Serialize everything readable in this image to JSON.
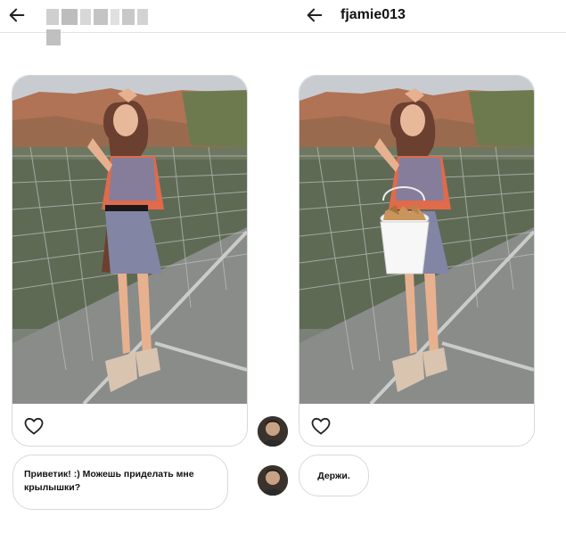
{
  "left_panel": {
    "header": {
      "back_icon": "arrow-left-icon",
      "username_blurred": true
    },
    "photo": {
      "description_icon": "photo-woman-on-bridge"
    },
    "like_icon": "heart-outline-icon",
    "message": "Приветик! :) Можешь приделать мне крылышки?"
  },
  "right_panel": {
    "header": {
      "back_icon": "arrow-left-icon",
      "username": "fjamie013"
    },
    "photo": {
      "description_icon": "photo-woman-with-bucket-of-wings"
    },
    "like_icon": "heart-outline-icon",
    "reply": "Держи."
  },
  "colors": {
    "border": "#d9d9d9",
    "text": "#111111",
    "divider": "#e3e3e3"
  }
}
